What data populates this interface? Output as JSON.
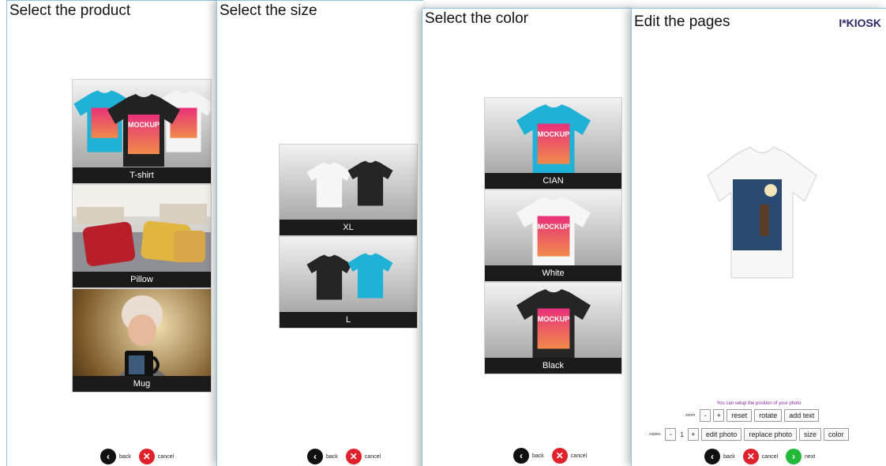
{
  "panels": {
    "product": {
      "title": "Select the product",
      "items": [
        {
          "label": "T-shirt"
        },
        {
          "label": "Pillow"
        },
        {
          "label": "Mug"
        }
      ],
      "back": "back",
      "cancel": "cancel"
    },
    "size": {
      "title": "Select the size",
      "items": [
        {
          "label": "XL"
        },
        {
          "label": "L"
        }
      ],
      "back": "back",
      "cancel": "cancel"
    },
    "color": {
      "title": "Select the color",
      "items": [
        {
          "label": "CIAN"
        },
        {
          "label": "White"
        },
        {
          "label": "Black"
        }
      ],
      "back": "back",
      "cancel": "cancel"
    },
    "edit": {
      "title": "Edit the pages",
      "logo": "I*KIOSK",
      "hint": "You can setup the position of your photo",
      "zoom_label": "zoom",
      "minus": "-",
      "plus": "+",
      "reset": "reset",
      "rotate": "rotate",
      "add_text": "add text",
      "copies_label": "copies",
      "copies_value": "1",
      "edit_photo": "edit photo",
      "replace_photo": "replace photo",
      "size": "size",
      "color": "color",
      "back": "back",
      "cancel": "cancel",
      "next": "next"
    }
  },
  "mockup_text": "MOCKUP",
  "colors": {
    "cyan": "#1fb2d6",
    "black": "#222222",
    "white": "#f4f4f4",
    "cancel": "#e0202a",
    "next": "#22b838",
    "hint": "#8a2aa8"
  }
}
